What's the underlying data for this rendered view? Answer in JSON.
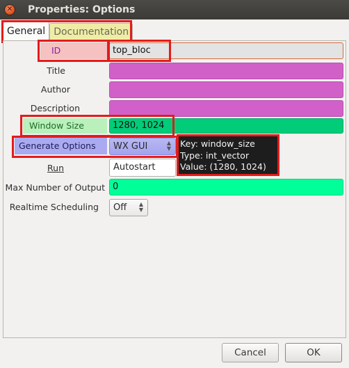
{
  "window": {
    "title": "Properties: Options",
    "close_glyph": "✕"
  },
  "tabs": [
    {
      "label": "General",
      "active": true
    },
    {
      "label": "Documentation",
      "active": false
    }
  ],
  "fields": {
    "id": {
      "label": "ID",
      "value": "top_bloc",
      "color": "#f5c1c1"
    },
    "title": {
      "label": "Title",
      "value": "",
      "color": "#d161c9"
    },
    "author": {
      "label": "Author",
      "value": "",
      "color": "#d161c9"
    },
    "description": {
      "label": "Description",
      "value": "",
      "color": "#d161c9"
    },
    "window_size": {
      "label": "Window Size",
      "value": "1280, 1024",
      "color": "#00cc7a"
    },
    "generate_options": {
      "label": "Generate Options",
      "value": "WX GUI",
      "color": "#aaaaf0"
    },
    "run": {
      "label": "Run",
      "value": "Autostart"
    },
    "max_outputs": {
      "label": "Max Number of Output",
      "value": "0",
      "color": "#00ff99"
    },
    "realtime": {
      "label": "Realtime Scheduling",
      "value": "Off"
    }
  },
  "tooltip": {
    "line1": "Key: window_size",
    "line2": "Type: int_vector",
    "line3": "Value: (1280, 1024)"
  },
  "buttons": {
    "cancel": "Cancel",
    "ok": "OK"
  },
  "icons": {
    "close": "close-icon",
    "spin_up": "▲",
    "spin_down": "▼"
  }
}
